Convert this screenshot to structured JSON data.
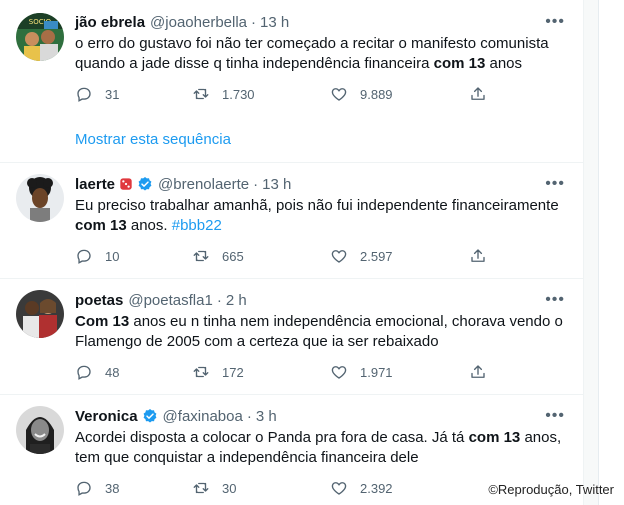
{
  "tweets": [
    {
      "name": "jão ebrela",
      "handle": "@joaoherbella",
      "time": "13 h",
      "text_before": "o erro do gustavo foi não ter começado a recitar o manifesto comunista quando a jade disse q tinha independência financeira ",
      "text_bold": "com 13",
      "text_after": " anos",
      "replies": "31",
      "retweets": "1.730",
      "likes": "9.889",
      "show_thread": "Mostrar esta sequência"
    },
    {
      "name": "laerte",
      "handle": "@brenolaerte",
      "time": "13 h",
      "text_before": "Eu preciso trabalhar amanhã, pois não fui independente financeiramente ",
      "text_bold": "com 13",
      "text_after": " anos. ",
      "hashtag": "#bbb22",
      "replies": "10",
      "retweets": "665",
      "likes": "2.597"
    },
    {
      "name": "poetas",
      "handle": "@poetasfla1",
      "time": "2 h",
      "text_bold": "Com 13",
      "text_after": " anos eu n tinha nem independência emocional, chorava vendo o Flamengo de 2005 com a certeza que ia ser rebaixado",
      "replies": "48",
      "retweets": "172",
      "likes": "1.971"
    },
    {
      "name": "Veronica",
      "handle": "@faxinaboa",
      "time": "3 h",
      "text_before": "Acordei disposta a colocar o Panda pra fora de casa. Já tá ",
      "text_bold": "com 13",
      "text_after": " anos, tem que conquistar a independência financeira dele",
      "replies": "38",
      "retweets": "30",
      "likes": "2.392"
    }
  ],
  "separator": "·",
  "more_glyph": "•••",
  "credit": "©Reprodução, Twitter",
  "colors": {
    "link": "#1d9bf0",
    "muted": "#536471",
    "text": "#0f1419"
  }
}
